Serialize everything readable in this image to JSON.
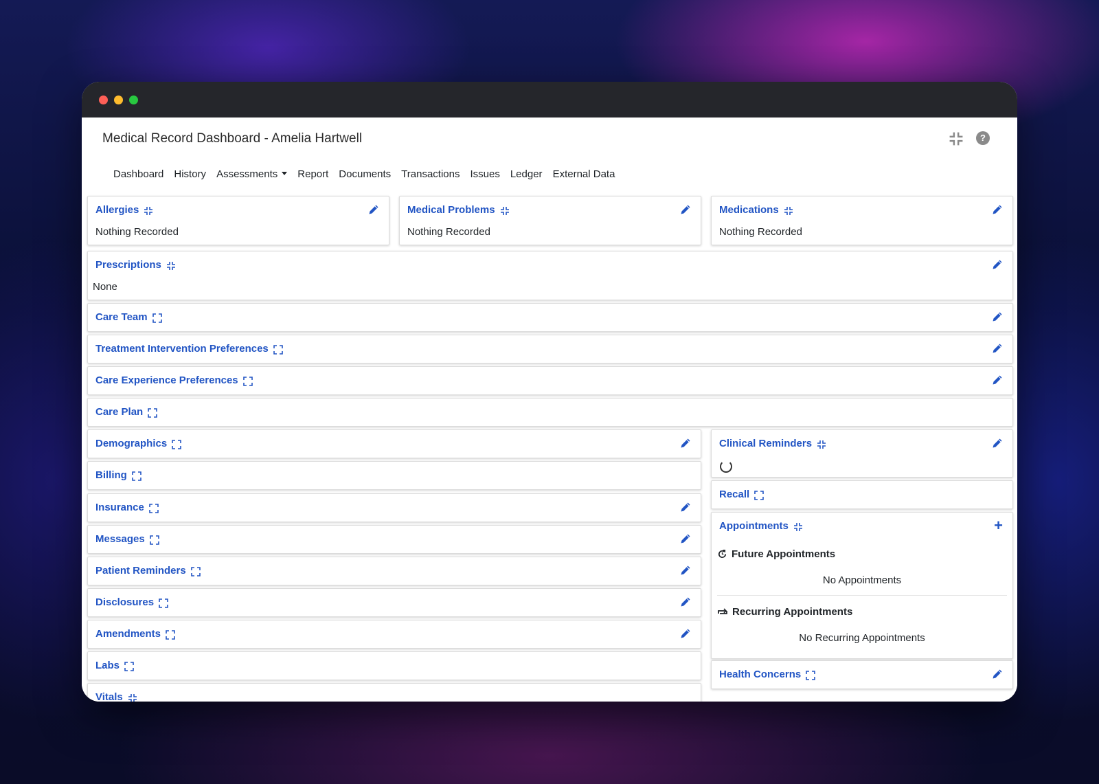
{
  "window": {
    "controls": [
      "close",
      "minimize",
      "maximize"
    ]
  },
  "header": {
    "title": "Medical Record Dashboard - Amelia Hartwell",
    "collapse_icon": "collapse-icon",
    "help_icon": "help-icon",
    "help_glyph": "?"
  },
  "nav": {
    "dashboard": "Dashboard",
    "history": "History",
    "assessments": "Assessments",
    "report": "Report",
    "documents": "Documents",
    "transactions": "Transactions",
    "issues": "Issues",
    "ledger": "Ledger",
    "external_data": "External Data"
  },
  "cards": {
    "allergies": {
      "title": "Allergies",
      "body": "Nothing Recorded"
    },
    "medical_problems": {
      "title": "Medical Problems",
      "body": "Nothing Recorded"
    },
    "medications": {
      "title": "Medications",
      "body": "Nothing Recorded"
    },
    "prescriptions": {
      "title": "Prescriptions",
      "body": "None"
    },
    "care_team": {
      "title": "Care Team"
    },
    "treatment_intervention_preferences": {
      "title": "Treatment Intervention Preferences"
    },
    "care_experience_preferences": {
      "title": "Care Experience Preferences"
    },
    "care_plan": {
      "title": "Care Plan"
    },
    "demographics": {
      "title": "Demographics"
    },
    "billing": {
      "title": "Billing"
    },
    "insurance": {
      "title": "Insurance"
    },
    "messages": {
      "title": "Messages"
    },
    "patient_reminders": {
      "title": "Patient Reminders"
    },
    "disclosures": {
      "title": "Disclosures"
    },
    "amendments": {
      "title": "Amendments"
    },
    "labs": {
      "title": "Labs"
    },
    "vitals": {
      "title": "Vitals"
    },
    "clinical_reminders": {
      "title": "Clinical Reminders"
    },
    "recall": {
      "title": "Recall"
    },
    "appointments": {
      "title": "Appointments",
      "future_heading": "Future Appointments",
      "future_empty": "No Appointments",
      "recurring_heading": "Recurring Appointments",
      "recurring_empty": "No Recurring Appointments"
    },
    "health_concerns": {
      "title": "Health Concerns"
    }
  },
  "colors": {
    "accent": "#2255c4",
    "titlebar": "#25262b"
  }
}
